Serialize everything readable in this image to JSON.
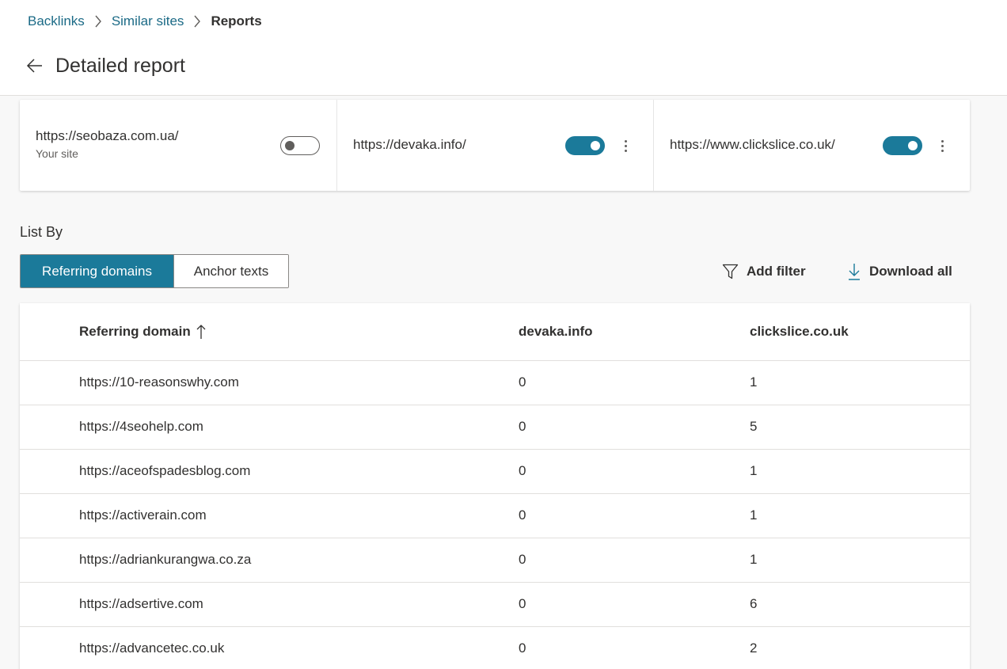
{
  "breadcrumb": {
    "items": [
      "Backlinks",
      "Similar sites"
    ],
    "current": "Reports"
  },
  "page": {
    "title": "Detailed report"
  },
  "sites": [
    {
      "url": "https://seobaza.com.ua/",
      "sublabel": "Your site",
      "toggle_on": false
    },
    {
      "url": "https://devaka.info/",
      "toggle_on": true
    },
    {
      "url": "https://www.clickslice.co.uk/",
      "toggle_on": true
    }
  ],
  "list_by": {
    "label": "List By",
    "options": [
      "Referring domains",
      "Anchor texts"
    ],
    "selected": "Referring domains"
  },
  "actions": {
    "add_filter": "Add filter",
    "download_all": "Download all"
  },
  "table": {
    "columns": [
      "Referring domain",
      "devaka.info",
      "clickslice.co.uk"
    ],
    "sort": {
      "column": "Referring domain",
      "direction": "ascending"
    },
    "rows": [
      [
        "https://10-reasonswhy.com",
        "0",
        "1"
      ],
      [
        "https://4seohelp.com",
        "0",
        "5"
      ],
      [
        "https://aceofspadesblog.com",
        "0",
        "1"
      ],
      [
        "https://activerain.com",
        "0",
        "1"
      ],
      [
        "https://adriankurangwa.co.za",
        "0",
        "1"
      ],
      [
        "https://adsertive.com",
        "0",
        "6"
      ],
      [
        "https://advancetec.co.uk",
        "0",
        "2"
      ]
    ]
  },
  "colors": {
    "accent": "#1b7a9a",
    "link": "#1b6a86",
    "text": "#323130"
  },
  "icons": {
    "breadcrumb_separator": "chevron-right-icon",
    "back": "arrow-left-icon",
    "more": "more-vertical-icon",
    "filter": "filter-icon",
    "download": "download-icon",
    "sort": "arrow-up-icon"
  }
}
